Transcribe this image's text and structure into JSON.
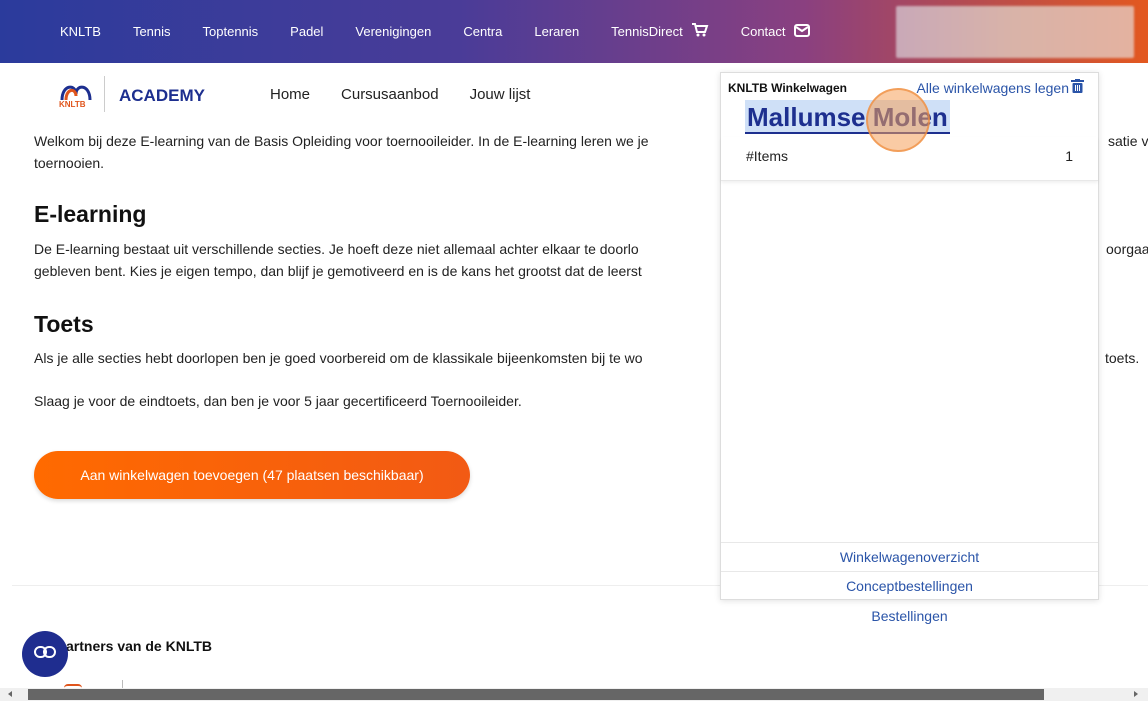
{
  "topnav": {
    "items": [
      "KNLTB",
      "Tennis",
      "Toptennis",
      "Padel",
      "Verenigingen",
      "Centra",
      "Leraren",
      "TennisDirect",
      "Contact"
    ]
  },
  "header": {
    "logo_text": "KNLTB",
    "brand": "ACADEMY",
    "nav": [
      "Home",
      "Cursusaanbod",
      "Jouw lijst"
    ]
  },
  "main": {
    "intro_line1": "Welkom bij deze E-learning van de Basis Opleiding voor toernooileider. In de E-learning leren we je",
    "intro_line1_tail": "satie va",
    "intro_line2": "toernooien.",
    "elearning_heading": "E-learning",
    "elearning_line1": "De E-learning bestaat uit verschillende secties. Je hoeft deze niet allemaal achter elkaar te doorlo",
    "elearning_line1_tail": "oorgaa",
    "elearning_line2": "gebleven bent. Kies je eigen tempo, dan blijf je gemotiveerd en is de kans het grootst dat de leerst",
    "toets_heading": "Toets",
    "toets_line1": "Als je alle secties hebt doorlopen ben je goed voorbereid om de klassikale bijeenkomsten bij te wo",
    "toets_line1_tail": "toets.",
    "toets_line2": "Slaag je voor de eindtoets, dan ben je voor 5 jaar gecertificeerd Toernooileider.",
    "cta_label": "Aan winkelwagen toevoegen (47 plaatsen beschikbaar)"
  },
  "footer": {
    "partners": "artners van de KNLTB"
  },
  "cart": {
    "title": "KNLTB Winkelwagen",
    "clear_label": "Alle winkelwagens legen",
    "name": "Mallumse Molen",
    "items_label": "#Items",
    "items_count": "1",
    "links": [
      "Winkelwagenoverzicht",
      "Conceptbestellingen",
      "Bestellingen"
    ]
  },
  "colors": {
    "brand_blue": "#1d2f8f",
    "accent_orange": "#ff6a00",
    "link_blue": "#2a54a8"
  }
}
